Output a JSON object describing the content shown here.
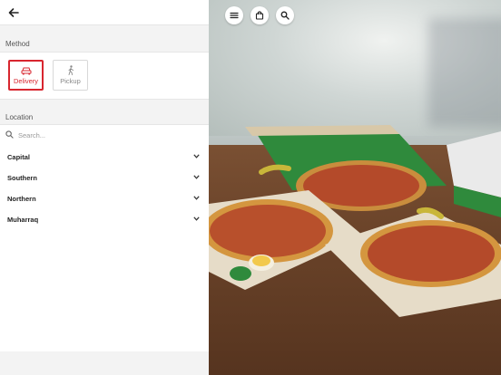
{
  "header": {
    "back_icon": "arrow-left-icon"
  },
  "method": {
    "title": "Method",
    "options": [
      {
        "label": "Delivery",
        "icon": "car-icon",
        "selected": true
      },
      {
        "label": "Pickup",
        "icon": "walking-person-icon",
        "selected": false
      }
    ]
  },
  "location": {
    "title": "Location",
    "search_placeholder": "Search...",
    "regions": [
      {
        "label": "Capital"
      },
      {
        "label": "Southern"
      },
      {
        "label": "Northern"
      },
      {
        "label": "Muharraq"
      }
    ]
  },
  "hero": {
    "buttons": [
      {
        "icon": "menu-icon"
      },
      {
        "icon": "shopping-bag-icon"
      },
      {
        "icon": "search-icon"
      }
    ]
  },
  "colors": {
    "accent": "#d8262f"
  }
}
